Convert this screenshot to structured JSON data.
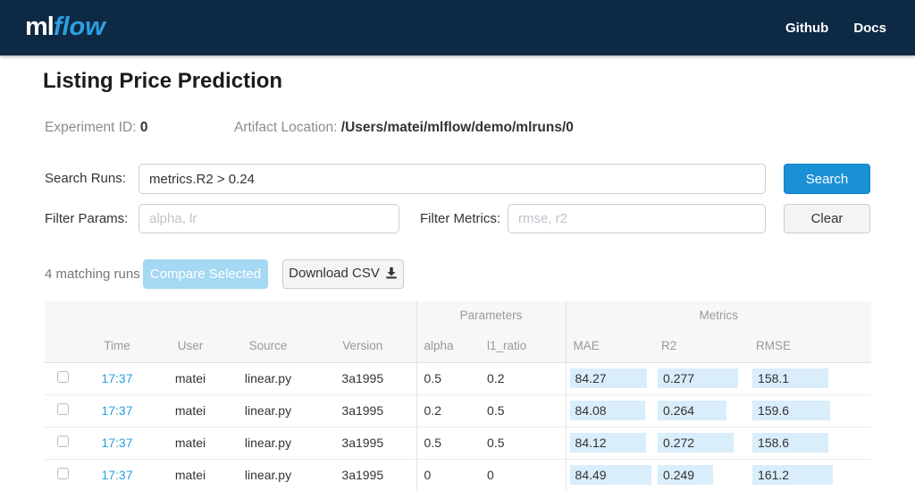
{
  "navbar": {
    "logo_ml": "ml",
    "logo_flow": "flow",
    "links": [
      {
        "label": "Github"
      },
      {
        "label": "Docs"
      }
    ]
  },
  "page": {
    "title": "Listing Price Prediction"
  },
  "experiment": {
    "id_label": "Experiment ID:",
    "id_value": "0",
    "artifact_label": "Artifact Location:",
    "artifact_value": "/Users/matei/mlflow/demo/mlruns/0"
  },
  "search": {
    "label": "Search Runs:",
    "value": "metrics.R2 > 0.24",
    "button": "Search"
  },
  "filters": {
    "params_label": "Filter Params:",
    "params_placeholder": "alpha, lr",
    "metrics_label": "Filter Metrics:",
    "metrics_placeholder": "rmse, r2",
    "clear_button": "Clear"
  },
  "actions": {
    "matching_runs": "4 matching runs",
    "compare_button": "Compare Selected",
    "download_button": "Download CSV",
    "download_icon": "download-icon"
  },
  "table": {
    "group_headers": {
      "parameters": "Parameters",
      "metrics": "Metrics"
    },
    "columns": {
      "time": "Time",
      "user": "User",
      "source": "Source",
      "version": "Version",
      "alpha": "alpha",
      "l1_ratio": "l1_ratio",
      "mae": "MAE",
      "r2": "R2",
      "rmse": "RMSE"
    },
    "runs": [
      {
        "time": "17:37",
        "user": "matei",
        "source": "linear.py",
        "version": "3a1995",
        "alpha": "0.5",
        "l1_ratio": "0.2",
        "mae": {
          "value": "84.27",
          "bar": 86
        },
        "r2": {
          "value": "0.277",
          "bar": 90
        },
        "rmse": {
          "value": "158.1",
          "bar": 85
        }
      },
      {
        "time": "17:37",
        "user": "matei",
        "source": "linear.py",
        "version": "3a1995",
        "alpha": "0.2",
        "l1_ratio": "0.5",
        "mae": {
          "value": "84.08",
          "bar": 84
        },
        "r2": {
          "value": "0.264",
          "bar": 77
        },
        "rmse": {
          "value": "159.6",
          "bar": 87
        }
      },
      {
        "time": "17:37",
        "user": "matei",
        "source": "linear.py",
        "version": "3a1995",
        "alpha": "0.5",
        "l1_ratio": "0.5",
        "mae": {
          "value": "84.12",
          "bar": 85
        },
        "r2": {
          "value": "0.272",
          "bar": 85
        },
        "rmse": {
          "value": "158.6",
          "bar": 85
        }
      },
      {
        "time": "17:37",
        "user": "matei",
        "source": "linear.py",
        "version": "3a1995",
        "alpha": "0",
        "l1_ratio": "0",
        "mae": {
          "value": "84.49",
          "bar": 91
        },
        "r2": {
          "value": "0.249",
          "bar": 62
        },
        "rmse": {
          "value": "161.2",
          "bar": 90
        }
      }
    ]
  },
  "colors": {
    "navbar_bg": "#0e2944",
    "logo_blue": "#2d9fe0",
    "primary_button": "#1a90d5",
    "compare_disabled": "#a4d8f3",
    "time_link": "#2b9fd9",
    "metric_bar_bg": "#d9edfb",
    "table_header_bg": "#f7f7f7"
  }
}
